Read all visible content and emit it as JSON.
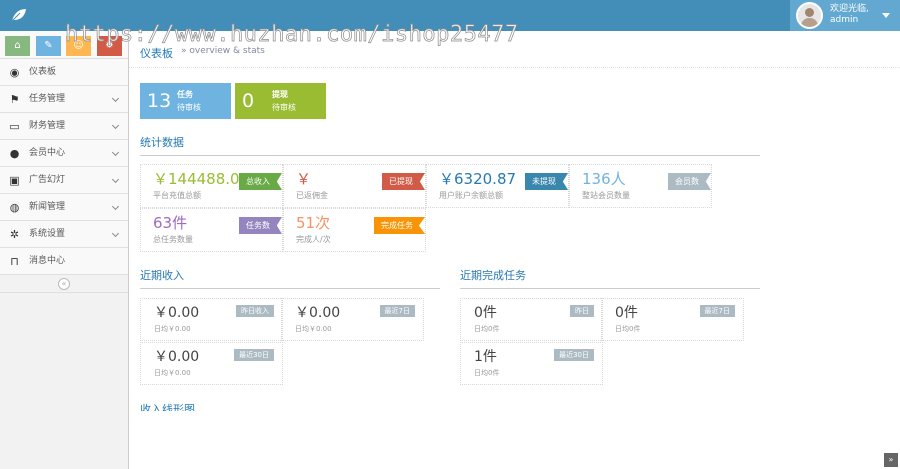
{
  "watermark": "https://www.huzhan.com/ishop25477",
  "user": {
    "welcome": "欢迎光临,",
    "name": "admin"
  },
  "breadcrumb": {
    "title": "仪表板",
    "sub": "» overview & stats"
  },
  "sidebar": {
    "items": [
      {
        "label": "仪表板",
        "icon": "dashboard-icon",
        "glyph": "◉",
        "arrow": false
      },
      {
        "label": "任务管理",
        "icon": "flag-icon",
        "glyph": "⚑",
        "arrow": true
      },
      {
        "label": "财务管理",
        "icon": "inbox-icon",
        "glyph": "▭",
        "arrow": true
      },
      {
        "label": "会员中心",
        "icon": "user-icon",
        "glyph": "●",
        "arrow": true
      },
      {
        "label": "广告幻灯",
        "icon": "picture-icon",
        "glyph": "▣",
        "arrow": true
      },
      {
        "label": "新闻管理",
        "icon": "globe-icon",
        "glyph": "◍",
        "arrow": true
      },
      {
        "label": "系统设置",
        "icon": "gear-icon",
        "glyph": "✲",
        "arrow": true
      },
      {
        "label": "消息中心",
        "icon": "bookmark-icon",
        "glyph": "⊓",
        "arrow": false
      }
    ],
    "collapse_glyph": "«"
  },
  "tiles": [
    {
      "num": "13",
      "label": "任务",
      "sub": "待审核"
    },
    {
      "num": "0",
      "label": "提现",
      "sub": "待审核"
    }
  ],
  "stats_title": "统计数据",
  "stats": [
    {
      "value": "￥144488.0",
      "caption": "平台充值总额",
      "tag": "总收入",
      "color": "#9abc32",
      "tagColor": "#69aa46"
    },
    {
      "value": "￥",
      "caption": "已返佣金",
      "tag": "已提现",
      "color": "#d15b47",
      "tagColor": "#d15b47"
    },
    {
      "value": "￥6320.87",
      "caption": "用户账户余额总额",
      "tag": "未提现",
      "color": "#2679b5",
      "tagColor": "#3a87ad"
    },
    {
      "value": "136人",
      "caption": "整站会员数量",
      "tag": "会员数",
      "color": "#6fb3e0",
      "tagColor": "#abbac3"
    },
    {
      "value": "63件",
      "caption": "总任务数量",
      "tag": "任务数",
      "color": "#a069c3",
      "tagColor": "#9585bf"
    },
    {
      "value": "51次",
      "caption": "完成人/次",
      "tag": "完成任务",
      "color": "#f79263",
      "tagColor": "#f89406"
    }
  ],
  "income": {
    "title": "近期收入",
    "boxes": [
      {
        "value": "￥0.00",
        "caption": "日均￥0.00",
        "tag": "昨日收入"
      },
      {
        "value": "￥0.00",
        "caption": "日均￥0.00",
        "tag": "最近7日"
      },
      {
        "value": "￥0.00",
        "caption": "日均￥0.00",
        "tag": "最近30日"
      }
    ]
  },
  "tasks": {
    "title": "近期完成任务",
    "boxes": [
      {
        "value": "0件",
        "caption": "日均0件",
        "tag": "昨日"
      },
      {
        "value": "0件",
        "caption": "日均0件",
        "tag": "最近7日"
      },
      {
        "value": "1件",
        "caption": "日均0件",
        "tag": "最近30日"
      }
    ]
  },
  "chart_section_title": "收入线形图",
  "scroll_top_glyph": "»"
}
